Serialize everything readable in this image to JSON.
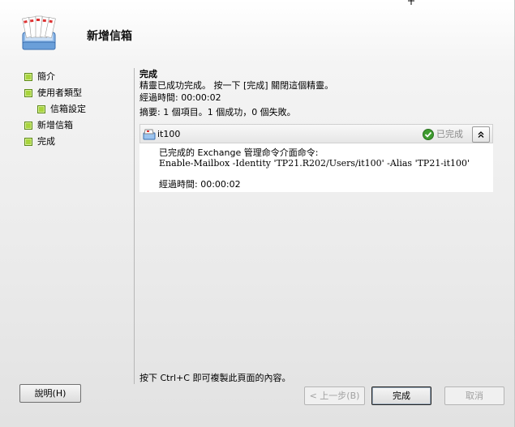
{
  "header": {
    "title": "新增信箱"
  },
  "steps": [
    {
      "label": "簡介"
    },
    {
      "label": "使用者類型"
    },
    {
      "label": "信箱設定"
    },
    {
      "label": "新增信箱"
    },
    {
      "label": "完成"
    }
  ],
  "content": {
    "section_title": "完成",
    "message": "精靈已成功完成。 按一下 [完成] 關閉這個精靈。",
    "elapsed": "經過時間: 00:00:02",
    "summary": "摘要: 1 個項目。1 個成功，0 個失敗。"
  },
  "result": {
    "item_name": "it100",
    "status": "已完成",
    "collapse_glyph": "⌃",
    "command_label": "已完成的 Exchange 管理命令介面命令:",
    "command": "Enable-Mailbox -Identity 'TP21.R202/Users/it100' -Alias 'TP21-it100'",
    "elapsed": "經過時間: 00:00:02"
  },
  "copy_hint": "按下 Ctrl+C 即可複製此頁面的內容。",
  "buttons": {
    "help": "說明(H)",
    "back": "< 上一步(B)",
    "finish": "完成",
    "cancel": "取消"
  },
  "colors": {
    "step_bullet": "#a8d43c",
    "status_ok": "#3e9c2f"
  },
  "icons": {
    "header": "mailbox-stack-icon",
    "result": "mailbox-icon",
    "status": "check-circle-icon"
  }
}
